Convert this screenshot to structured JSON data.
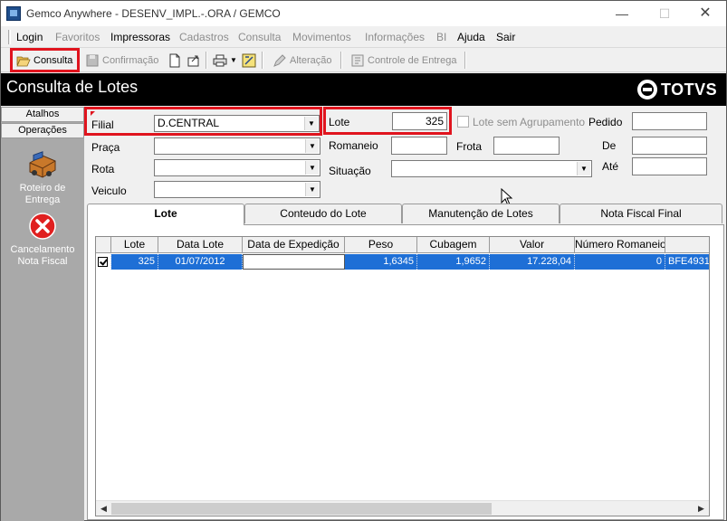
{
  "window": {
    "title": "Gemco Anywhere - DESENV_IMPL.-.ORA / GEMCO",
    "min_glyph": "—",
    "max_glyph": "☐",
    "close_glyph": "✕"
  },
  "menu": {
    "items": [
      {
        "label": "Login",
        "enabled": true
      },
      {
        "label": "Favoritos",
        "enabled": false
      },
      {
        "label": "Impressoras",
        "enabled": true
      },
      {
        "label": "Cadastros",
        "enabled": false
      },
      {
        "label": "Consulta",
        "enabled": false
      },
      {
        "label": "Movimentos",
        "enabled": false
      },
      {
        "label": "Informações",
        "enabled": false
      },
      {
        "label": "BI",
        "enabled": false
      },
      {
        "label": "Ajuda",
        "enabled": true
      },
      {
        "label": "Sair",
        "enabled": true
      }
    ]
  },
  "toolbar": {
    "consulta_label": "Consulta",
    "confirmacao_label": "Confirmação",
    "alteracao_label": "Alteração",
    "controle_entrega_label": "Controle de Entrega"
  },
  "header": {
    "title": "Consulta de Lotes",
    "brand": "TOTVS"
  },
  "sidebar": {
    "tab_atalhos": "Atalhos",
    "tab_operacoes": "Operações",
    "items": [
      {
        "label": "Roteiro de Entrega",
        "icon": "truck-icon"
      },
      {
        "label": "Cancelamento Nota Fiscal",
        "icon": "cancel-icon"
      }
    ]
  },
  "form": {
    "filial_label": "Filial",
    "filial_value": "D.CENTRAL",
    "praca_label": "Praça",
    "praca_value": "",
    "rota_label": "Rota",
    "rota_value": "",
    "veiculo_label": "Veiculo",
    "veiculo_value": "",
    "lote_label": "Lote",
    "lote_value": "325",
    "lote_sem_agrupamento_label": "Lote sem Agrupamento",
    "romaneio_label": "Romaneio",
    "romaneio_value": "",
    "frota_label": "Frota",
    "frota_value": "",
    "situacao_label": "Situação",
    "situacao_value": "",
    "pedido_label": "Pedido",
    "pedido_value": "",
    "de_label": "De",
    "de_value": "",
    "ate_label": "Até",
    "ate_value": ""
  },
  "tabs": [
    {
      "label": "Lote",
      "active": true
    },
    {
      "label": "Conteudo do Lote",
      "active": false
    },
    {
      "label": "Manutenção de Lotes",
      "active": false
    },
    {
      "label": "Nota Fiscal Final",
      "active": false
    }
  ],
  "grid": {
    "columns": [
      "",
      "Lote",
      "Data Lote",
      "Data de Expedição",
      "Peso",
      "Cubagem",
      "Valor",
      "Número Romaneio",
      ""
    ],
    "rows": [
      {
        "checked": true,
        "lote": "325",
        "data_lote": "01/07/2012",
        "data_expedicao": "",
        "peso": "1,6345",
        "cubagem": "1,9652",
        "valor": "17.228,04",
        "numero_romaneio": "0",
        "extra": "BFE4931"
      }
    ]
  },
  "colors": {
    "highlight": "#e0141e",
    "selection": "#1e6fd6",
    "header_band": "#000000",
    "sidebar": "#a9a9a9"
  }
}
